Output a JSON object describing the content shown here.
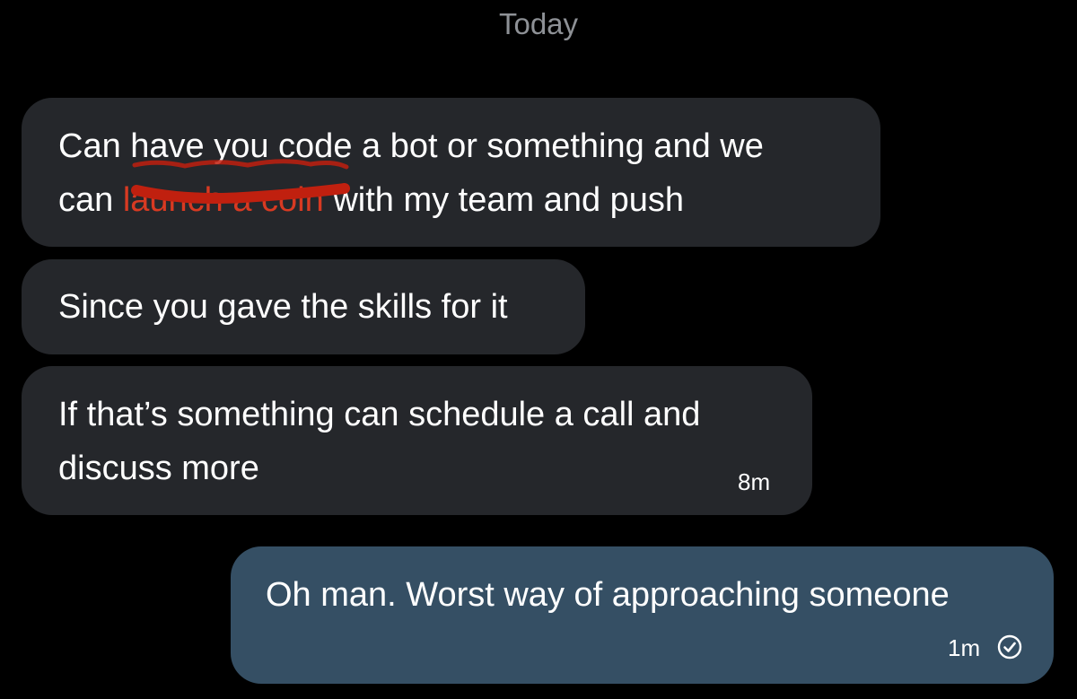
{
  "conversation": {
    "date_divider": "Today",
    "messages": [
      {
        "direction": "incoming",
        "lines": [
          {
            "before": "Can have you code a bot or something  and we",
            "highlight": "",
            "after": ""
          },
          {
            "before": "can ",
            "highlight": "launch a coin",
            "after": " with my team and push"
          }
        ]
      },
      {
        "direction": "incoming",
        "lines": [
          {
            "before": "Since you gave the skills for it"
          }
        ]
      },
      {
        "direction": "incoming",
        "lines": [
          {
            "before": "If that’s something can schedule a call and"
          },
          {
            "before": "discuss more"
          }
        ],
        "time": "8m"
      },
      {
        "direction": "outgoing",
        "lines": [
          {
            "before": "Oh man. Worst way of approaching someone"
          }
        ],
        "time": "1m",
        "status_icon": "read-check-icon"
      }
    ]
  },
  "colors": {
    "background": "#000000",
    "incoming_bubble": "#25272b",
    "outgoing_bubble": "#354f64",
    "highlight_text": "#d83a22",
    "highlight_mark": "#c0200f",
    "date_text": "#8e9196"
  }
}
